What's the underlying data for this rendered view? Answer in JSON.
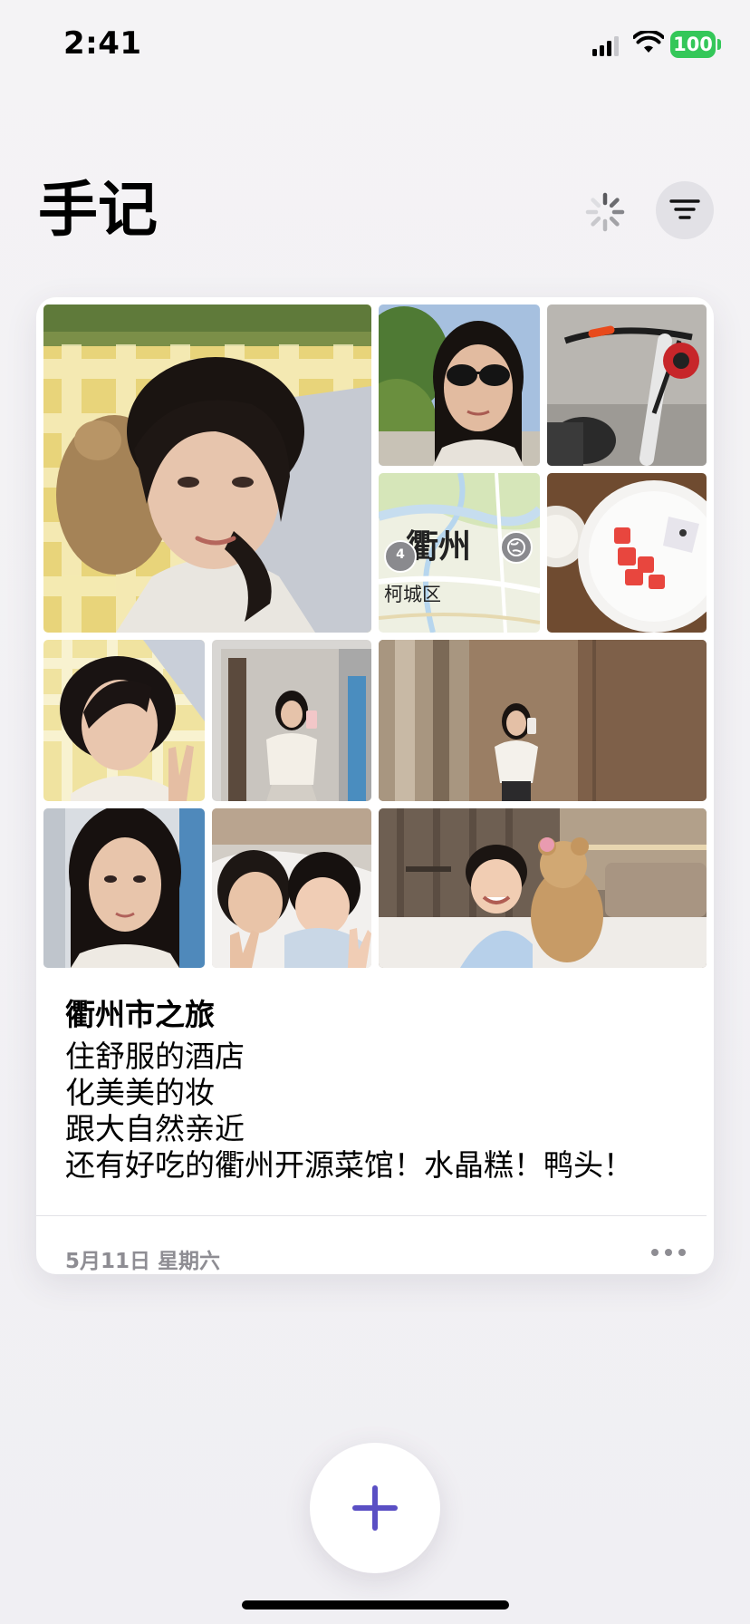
{
  "status_bar": {
    "time": "2:41",
    "battery_level": "100",
    "icons": [
      "signal-icon",
      "wifi-icon",
      "battery-icon"
    ]
  },
  "header": {
    "title": "手记",
    "icons": [
      "loading-spinner-icon",
      "filter-icon"
    ]
  },
  "entry": {
    "title": "衢州市之旅",
    "body_lines": [
      "住舒服的酒店",
      "化美美的妆",
      "跟大自然亲近",
      "还有好吃的衢州开源菜馆！水晶糕！鸭头！"
    ],
    "date": "5月11日 星期六",
    "map": {
      "city_label": "衢州",
      "district_label": "柯城区",
      "pin_count": "4"
    },
    "photos": [
      "selfie-on-picnic-blanket",
      "sunglasses-selfie",
      "bicycle",
      "map",
      "watermelon-plate",
      "peace-sign-selfie",
      "mirror-selfie",
      "hotel-hallway-mirror-selfie",
      "portrait-closeup",
      "selfie-with-child",
      "child-with-teddy-bear"
    ]
  },
  "colors": {
    "accent": "#5a4fc4",
    "battery": "#34c759",
    "background": "#f2f1f5",
    "card": "#ffffff",
    "secondary_text": "#8e8d93"
  },
  "actions": {
    "add_icon": "plus-icon",
    "more_icon": "ellipsis-icon"
  }
}
